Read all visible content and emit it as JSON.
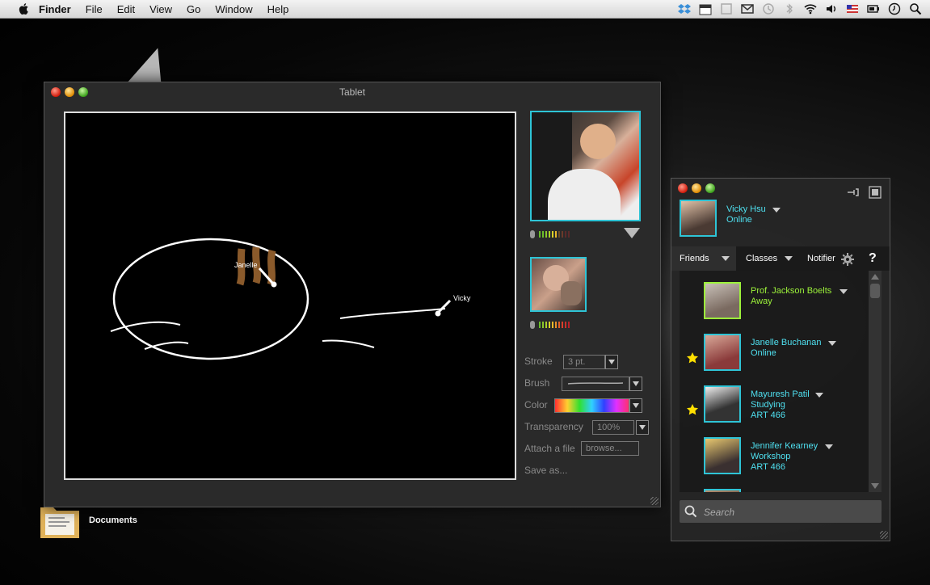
{
  "menubar": {
    "items": [
      "Finder",
      "File",
      "Edit",
      "View",
      "Go",
      "Window",
      "Help"
    ]
  },
  "desktop": {
    "folder_label": "Documents"
  },
  "tablet": {
    "title": "Tablet",
    "cursor_janelle": "Janelle",
    "cursor_vicky": "Vicky",
    "stroke_label": "Stroke",
    "stroke_value": "3 pt.",
    "brush_label": "Brush",
    "color_label": "Color",
    "transparency_label": "Transparency",
    "transparency_value": "100%",
    "attach_label": "Attach a file",
    "browse_label": "browse...",
    "save_label": "Save as..."
  },
  "friends": {
    "me": {
      "name": "Vicky Hsu",
      "status": "Online"
    },
    "tabs": [
      "Friends",
      "Classes",
      "Notifier"
    ],
    "help": "?",
    "list": [
      {
        "name": "Prof. Jackson Boelts",
        "line2": "Away",
        "line3": "",
        "starred": false,
        "color": "#9cf23a"
      },
      {
        "name": "Janelle Buchanan",
        "line2": "Online",
        "line3": "",
        "starred": true,
        "color": "#4fe0f0"
      },
      {
        "name": "Mayuresh Patil",
        "line2": "Studying",
        "line3": "ART 466",
        "starred": true,
        "color": "#4fe0f0"
      },
      {
        "name": "Jennifer Kearney",
        "line2": "Workshop",
        "line3": "ART 466",
        "starred": false,
        "color": "#4fe0f0"
      }
    ],
    "search_placeholder": "Search"
  }
}
